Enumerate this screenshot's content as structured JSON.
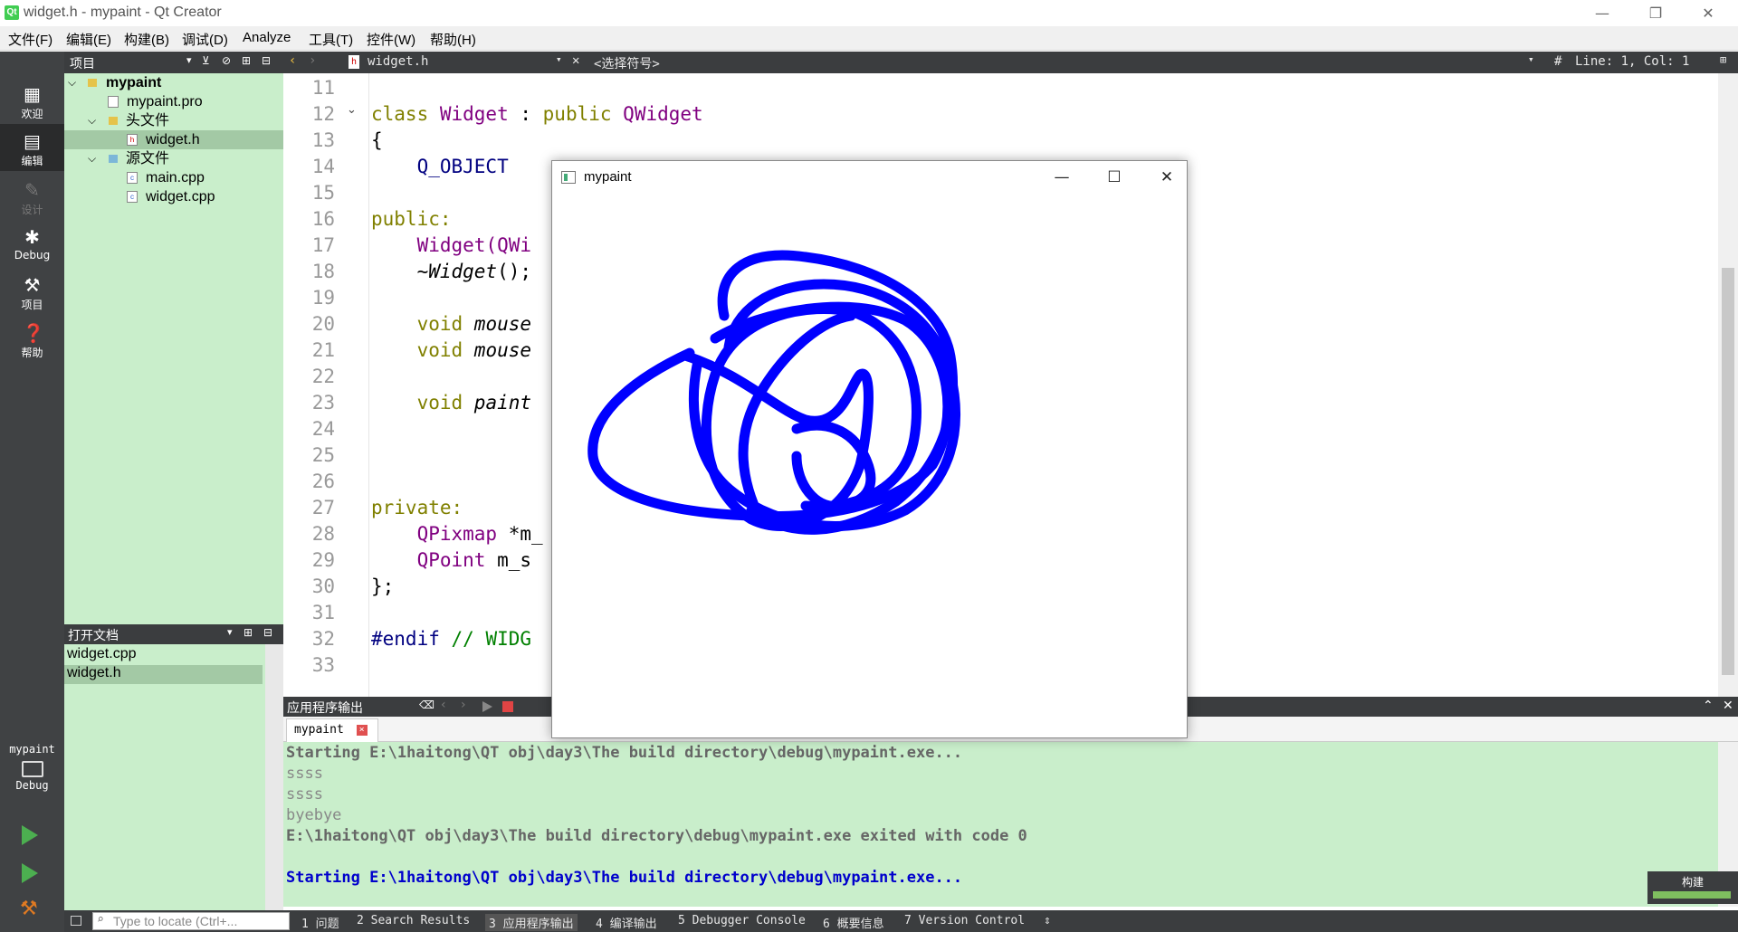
{
  "window": {
    "title": "widget.h - mypaint - Qt Creator",
    "app_icon": "Qt",
    "minimize_icon": "—",
    "restore_icon": "❐",
    "close_icon": "✕"
  },
  "menu": [
    "文件(F)",
    "编辑(E)",
    "构建(B)",
    "调试(D)",
    "Analyze",
    "工具(T)",
    "控件(W)",
    "帮助(H)"
  ],
  "modes": [
    {
      "label": "欢迎",
      "icon": "grid-icon"
    },
    {
      "label": "编辑",
      "icon": "edit-icon"
    },
    {
      "label": "设计",
      "icon": "pencil-icon"
    },
    {
      "label": "Debug",
      "icon": "bug-icon"
    },
    {
      "label": "项目",
      "icon": "wrench-icon"
    },
    {
      "label": "帮助",
      "icon": "help-icon"
    }
  ],
  "kit": {
    "project": "mypaint",
    "mode": "Debug"
  },
  "navigator": {
    "title": "项目"
  },
  "tree": [
    {
      "label": "mypaint",
      "level": 0
    },
    {
      "label": "mypaint.pro",
      "level": 1
    },
    {
      "label": "头文件",
      "level": 1
    },
    {
      "label": "widget.h",
      "level": 2
    },
    {
      "label": "源文件",
      "level": 1
    },
    {
      "label": "main.cpp",
      "level": 2
    },
    {
      "label": "widget.cpp",
      "level": 2
    }
  ],
  "open_docs": {
    "title": "打开文档",
    "items": [
      "widget.cpp",
      "widget.h"
    ]
  },
  "editor_header": {
    "file": "widget.h",
    "symbol": "<选择符号>",
    "position": "Line: 1, Col: 1",
    "hash": "#"
  },
  "code_lines": [
    "11",
    "12",
    "13",
    "14",
    "15",
    "16",
    "17",
    "18",
    "19",
    "20",
    "21",
    "22",
    "23",
    "24",
    "25",
    "26",
    "27",
    "28",
    "29",
    "30",
    "31",
    "32",
    "33"
  ],
  "code": {
    "l12a": "class ",
    "l12b": "Widget",
    "l12c": " : ",
    "l12d": "public ",
    "l12e": "QWidget",
    "l13": "{",
    "l14": "    Q_OBJECT",
    "l16": "public:",
    "l17a": "    ",
    "l17b": "Widget",
    "l17c": "(QWi",
    "l18a": "    ~",
    "l18b": "Widget",
    "l18c": "();",
    "l20a": "    void ",
    "l20b": "mouse",
    "l21a": "    void ",
    "l21b": "mouse",
    "l23a": "    void ",
    "l23b": "paint",
    "l27": "private:",
    "l28a": "    QPixmap ",
    "l28b": "*m_",
    "l29a": "    QPoint ",
    "l29b": "m_s",
    "l30": "};",
    "l32a": "#endif ",
    "l32b": "// WIDG"
  },
  "output": {
    "title": "应用程序输出",
    "tab": "mypaint",
    "lines": [
      "Starting E:\\1haitong\\QT obj\\day3\\The build directory\\debug\\mypaint.exe...",
      "ssss",
      "ssss",
      "byebye",
      "E:\\1haitong\\QT obj\\day3\\The build directory\\debug\\mypaint.exe exited with code 0",
      "",
      "Starting E:\\1haitong\\QT obj\\day3\\The build directory\\debug\\mypaint.exe..."
    ]
  },
  "statusbar": {
    "locate_placeholder": "Type to locate (Ctrl+...",
    "items": [
      "1 问题",
      "2 Search Results",
      "3 应用程序输出",
      "4 编译输出",
      "5 Debugger Console",
      "6 概要信息",
      "7 Version Control"
    ]
  },
  "build_label": "构建",
  "paint_window": {
    "title": "mypaint",
    "stroke_color": "#0000ff"
  },
  "colors": {
    "sidebar": "#404244",
    "tree_bg": "#c9eecb",
    "keyword": "#808000",
    "class": "#800080"
  }
}
